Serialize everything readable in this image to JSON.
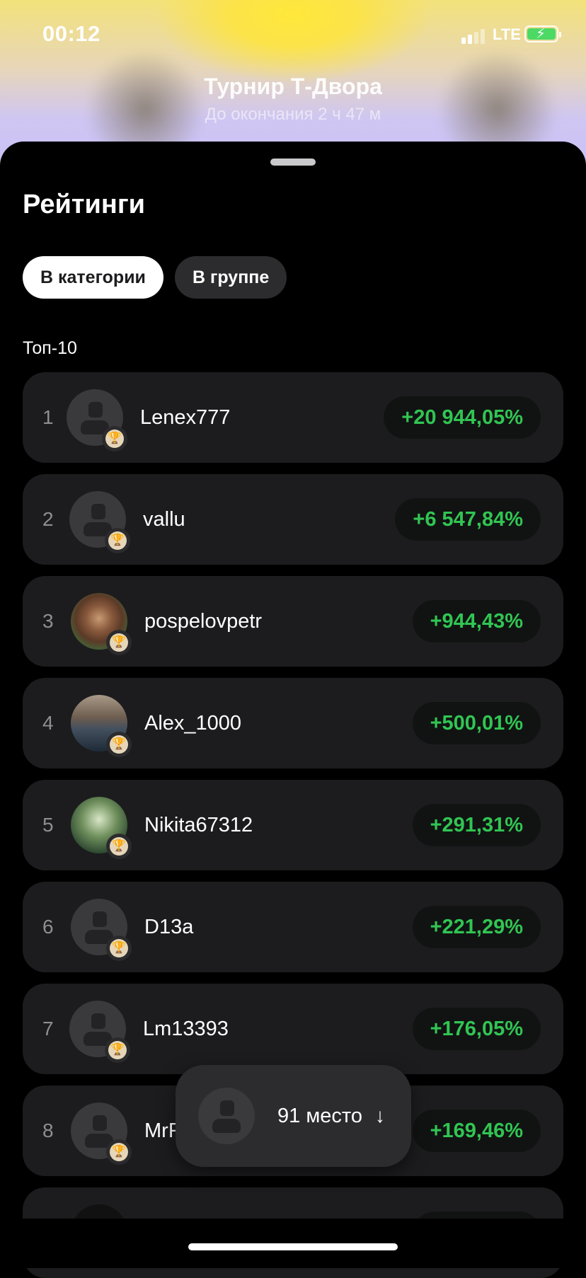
{
  "status_bar": {
    "time": "00:12",
    "network": "LTE"
  },
  "header": {
    "title": "Турнир Т-Двора",
    "subtitle": "До окончания 2 ч 47 м"
  },
  "sheet": {
    "title": "Рейтинги",
    "tabs": [
      {
        "label": "В категории",
        "active": true
      },
      {
        "label": "В группе",
        "active": false
      }
    ],
    "section_label": "Топ-10",
    "rows": [
      {
        "rank": "1",
        "name": "Lenex777",
        "value": "+20 944,05%",
        "avatar": "placeholder"
      },
      {
        "rank": "2",
        "name": "vallu",
        "value": "+6 547,84%",
        "avatar": "placeholder"
      },
      {
        "rank": "3",
        "name": "pospelovpetr",
        "value": "+944,43%",
        "avatar": "photo"
      },
      {
        "rank": "4",
        "name": "Alex_1000",
        "value": "+500,01%",
        "avatar": "photo"
      },
      {
        "rank": "5",
        "name": "Nikita67312",
        "value": "+291,31%",
        "avatar": "photo"
      },
      {
        "rank": "6",
        "name": "D13a",
        "value": "+221,29%",
        "avatar": "placeholder"
      },
      {
        "rank": "7",
        "name": "Lm13393",
        "value": "+176,05%",
        "avatar": "placeholder"
      },
      {
        "rank": "8",
        "name": "MrF",
        "value": "+169,46%",
        "avatar": "placeholder"
      }
    ]
  },
  "my_place": {
    "label": "91 место",
    "icon": "arrow-down-icon"
  },
  "colors": {
    "positive": "#31c553",
    "row_bg": "#1c1c1e",
    "pill_bg": "#111312",
    "active_tab_bg": "#ffffff"
  }
}
